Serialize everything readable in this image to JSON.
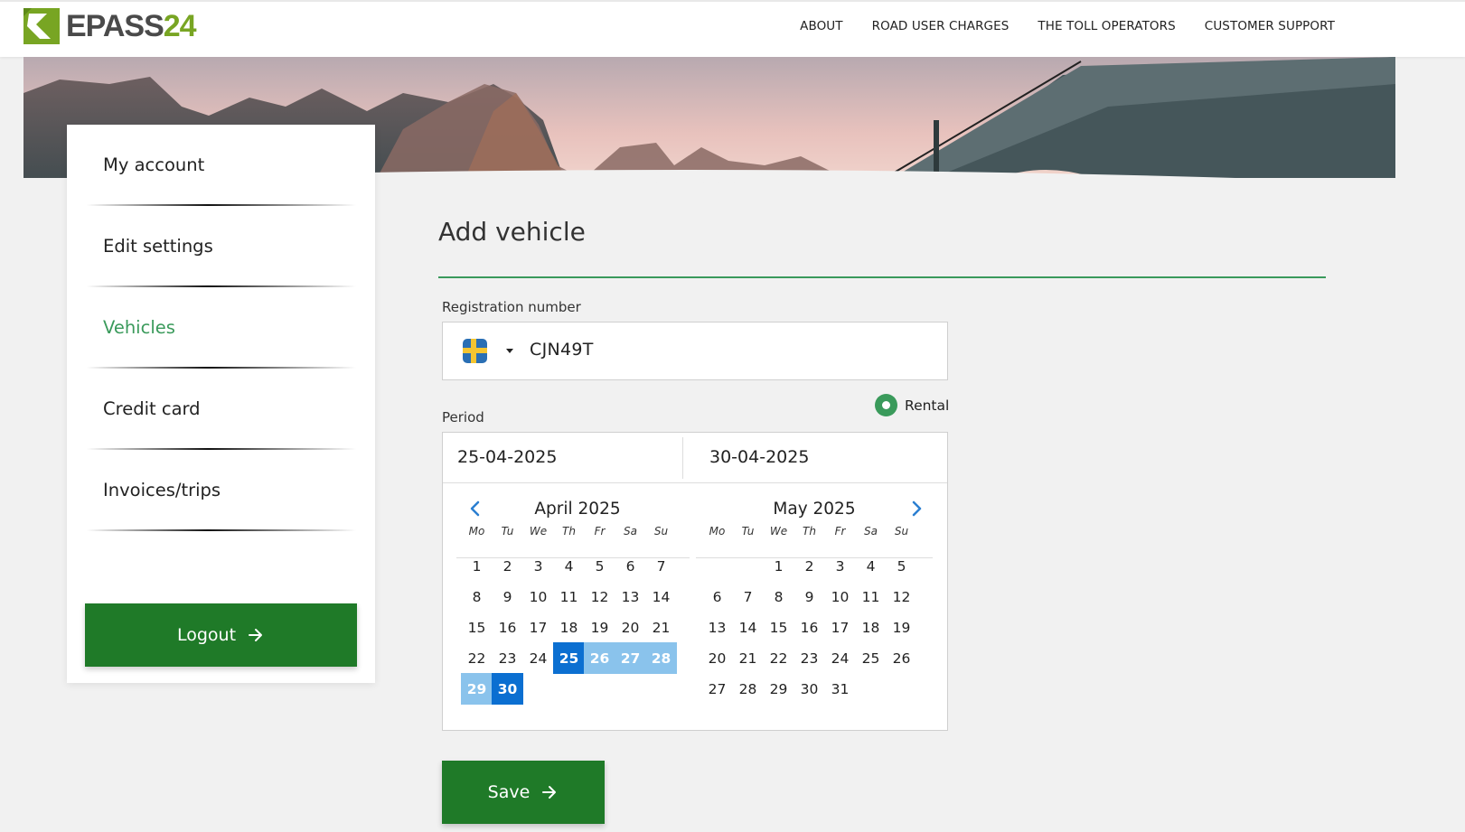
{
  "brand": {
    "logo_part1": "EPASS",
    "logo_part2": "24"
  },
  "nav": [
    "ABOUT",
    "ROAD USER CHARGES",
    "THE TOLL OPERATORS",
    "CUSTOMER SUPPORT"
  ],
  "sidebar": {
    "items": [
      {
        "label": "My account"
      },
      {
        "label": "Edit settings"
      },
      {
        "label": "Vehicles"
      },
      {
        "label": "Credit card"
      },
      {
        "label": "Invoices/trips"
      }
    ],
    "logout_label": "Logout"
  },
  "main": {
    "title": "Add vehicle",
    "registration_label": "Registration number",
    "registration_value": "CJN49T",
    "country_icon": "sweden-flag-icon",
    "rental_label": "Rental",
    "rental_selected": true,
    "period_label": "Period",
    "start_date": "25-04-2025",
    "end_date": "30-04-2025",
    "save_label": "Save"
  },
  "calendar": {
    "weekdays": [
      "Mo",
      "Tu",
      "We",
      "Th",
      "Fr",
      "Sa",
      "Su"
    ],
    "months": [
      {
        "title": "April 2025",
        "first_weekday": 1,
        "days": 30
      },
      {
        "title": "May 2025",
        "first_weekday": 3,
        "days": 31
      }
    ],
    "selected": {
      "month": 0,
      "days": [
        25,
        30
      ]
    },
    "in_range": {
      "month": 0,
      "days": [
        26,
        27,
        28,
        29
      ]
    }
  },
  "colors": {
    "accent_green": "#1f7a28",
    "active_green": "#3a9a5b",
    "selected_blue": "#0b6fd1",
    "range_blue": "#8ac3ec",
    "logo_green": "#78a523"
  }
}
